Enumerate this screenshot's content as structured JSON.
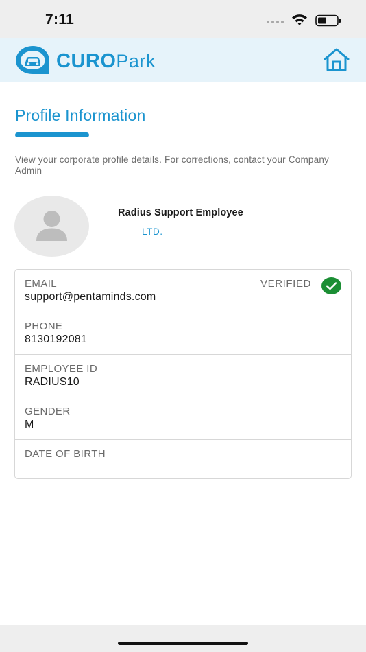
{
  "status_bar": {
    "time": "7:11"
  },
  "header": {
    "logo_bold": "CURO",
    "logo_light": "Park",
    "home_icon": "home-icon",
    "accent_color": "#1b94cf"
  },
  "page": {
    "title": "Profile Information",
    "description": "View your corporate profile details. For corrections, contact your Company Admin"
  },
  "profile": {
    "name": "Radius Support Employee",
    "company": "LTD."
  },
  "fields": {
    "email": {
      "label": "EMAIL",
      "value": "support@pentaminds.com",
      "status": "VERIFIED",
      "status_color": "#1b8e34"
    },
    "phone": {
      "label": "PHONE",
      "value": "8130192081"
    },
    "employee_id": {
      "label": "EMPLOYEE ID",
      "value": "RADIUS10"
    },
    "gender": {
      "label": "GENDER",
      "value": "M"
    },
    "date_of_birth": {
      "label": "DATE OF BIRTH",
      "value": ""
    }
  }
}
